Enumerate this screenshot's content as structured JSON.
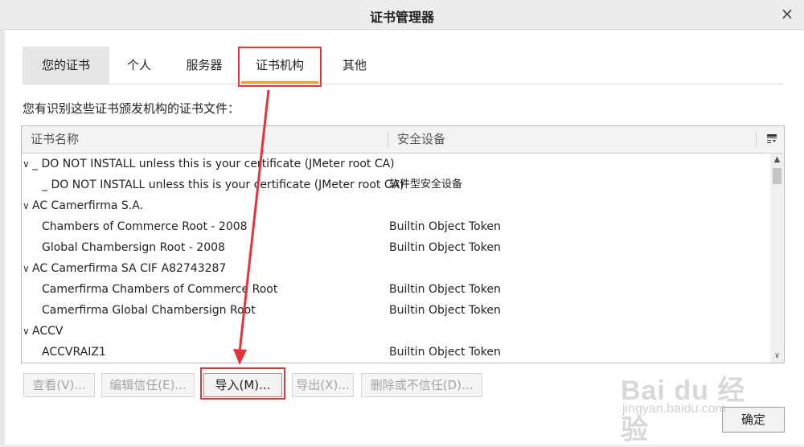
{
  "window": {
    "title": "证书管理器",
    "close_icon": "×"
  },
  "tabs": [
    {
      "label": "您的证书"
    },
    {
      "label": "个人"
    },
    {
      "label": "服务器"
    },
    {
      "label": "证书机构"
    },
    {
      "label": "其他"
    }
  ],
  "active_tab": "证书机构",
  "description": "您有识别这些证书颁发机构的证书文件：",
  "table": {
    "columns": [
      "证书名称",
      "安全设备"
    ],
    "rows": [
      {
        "type": "group",
        "name": "_ DO NOT INSTALL unless this is your certificate (JMeter root CA)",
        "device": ""
      },
      {
        "type": "item",
        "name": "_ DO NOT INSTALL unless this is your certificate (JMeter root CA)",
        "device": "软件型安全设备"
      },
      {
        "type": "group",
        "name": "AC Camerfirma S.A.",
        "device": ""
      },
      {
        "type": "item",
        "name": "Chambers of Commerce Root - 2008",
        "device": "Builtin Object Token"
      },
      {
        "type": "item",
        "name": "Global Chambersign Root - 2008",
        "device": "Builtin Object Token"
      },
      {
        "type": "group",
        "name": "AC Camerfirma SA CIF A82743287",
        "device": ""
      },
      {
        "type": "item",
        "name": "Camerfirma Chambers of Commerce Root",
        "device": "Builtin Object Token"
      },
      {
        "type": "item",
        "name": "Camerfirma Global Chambersign Root",
        "device": "Builtin Object Token"
      },
      {
        "type": "group",
        "name": "ACCV",
        "device": ""
      },
      {
        "type": "item",
        "name": "ACCVRAIZ1",
        "device": "Builtin Object Token"
      }
    ]
  },
  "buttons": {
    "view": "查看(V)...",
    "edit_trust": "编辑信任(E)...",
    "import": "导入(M)...",
    "export": "导出(X)...",
    "delete": "删除或不信任(D)...",
    "ok": "确定"
  },
  "watermark": {
    "main": "Bai du 经验",
    "sub": "jingyan.baidu.com"
  },
  "colors": {
    "highlight": "#e8323a",
    "active_tab_underline": "#f0a030"
  }
}
